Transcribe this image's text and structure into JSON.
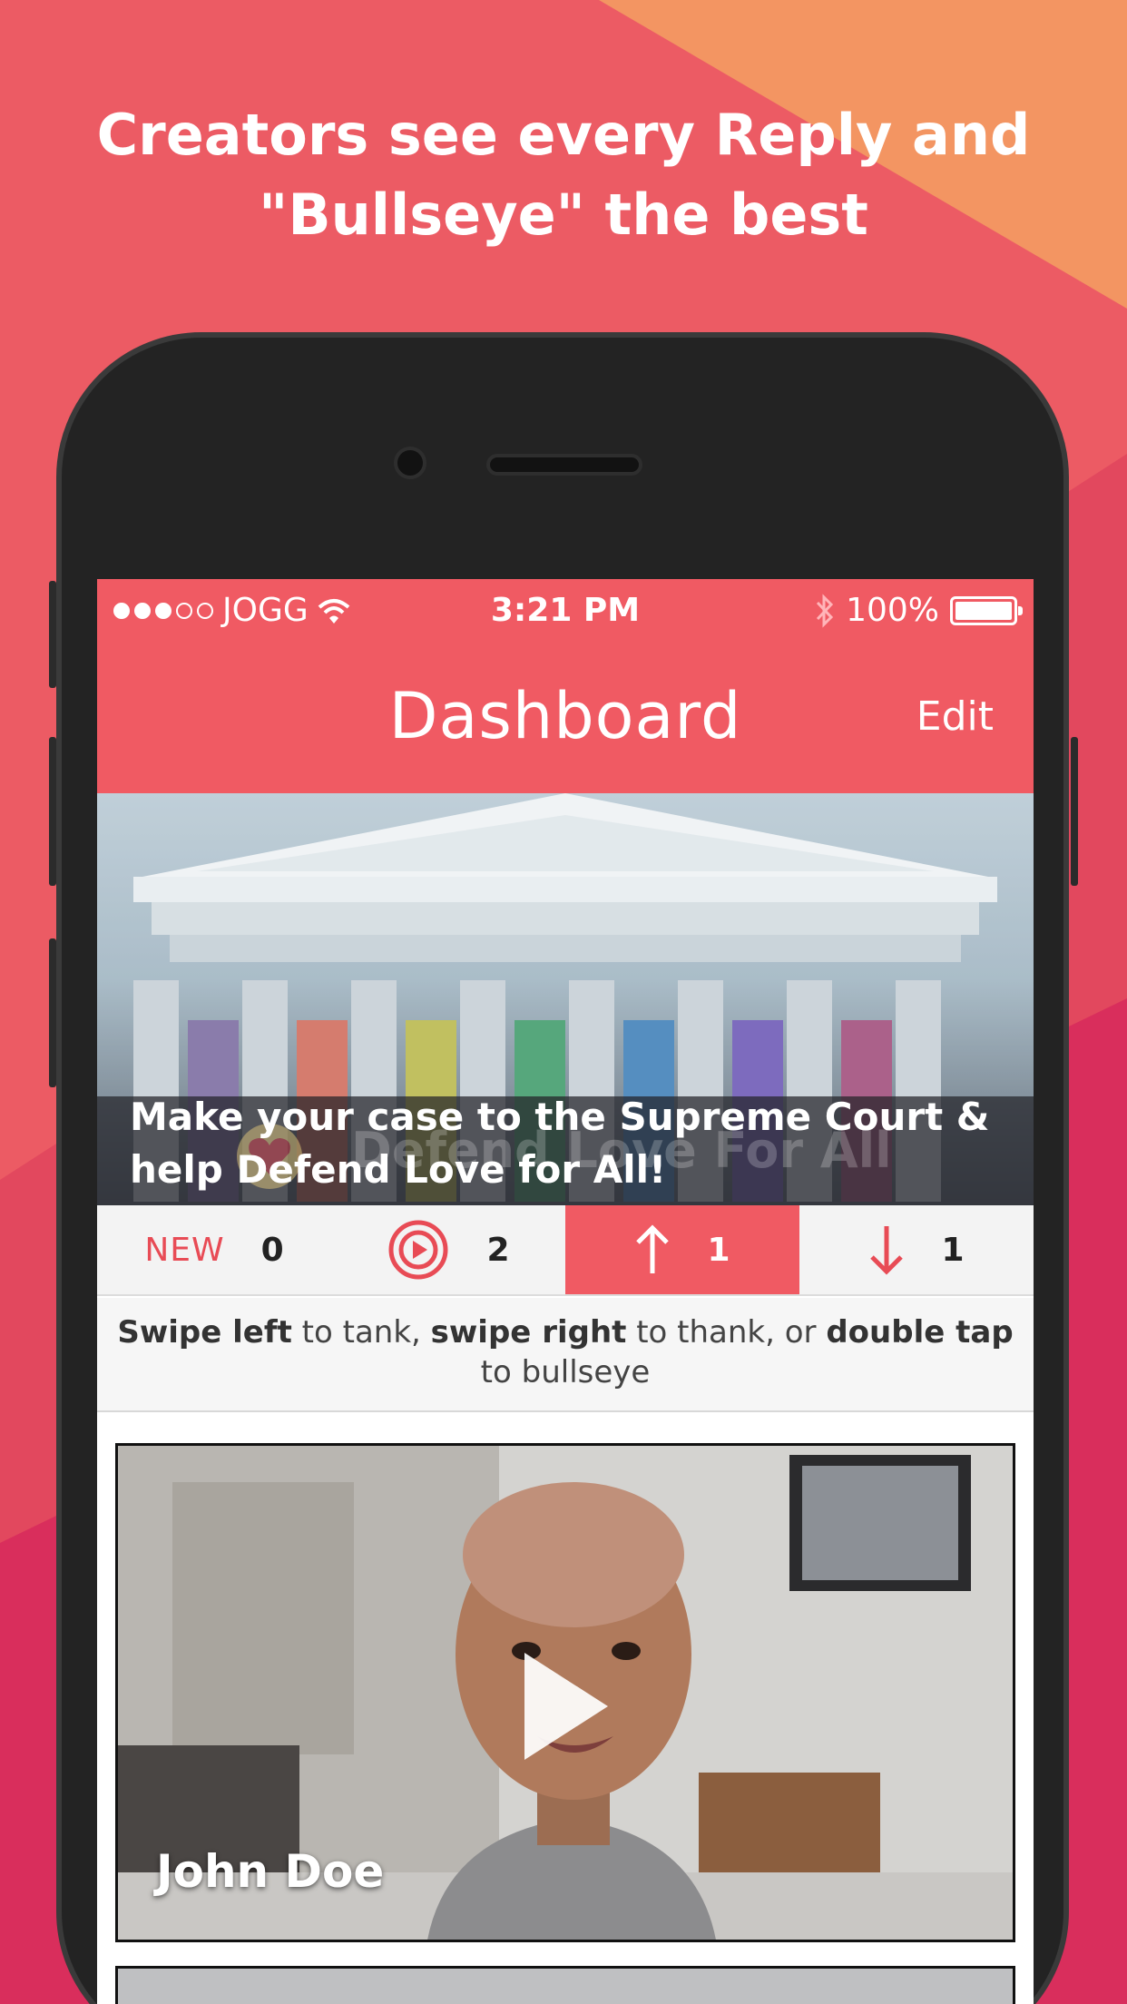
{
  "promo": {
    "headline_line1": "Creators see every Reply and",
    "headline_line2": "\"Bullseye\" the best"
  },
  "status_bar": {
    "carrier": "JOGG",
    "time": "3:21 PM",
    "battery": "100%"
  },
  "nav": {
    "title": "Dashboard",
    "edit_label": "Edit"
  },
  "hero": {
    "title_line1": "Make your case to the Supreme Court &",
    "title_line2": "help Defend Love for All!",
    "watermark": "Defend Love For All"
  },
  "tabs": [
    {
      "label": "NEW",
      "count": "0",
      "icon": "new-label"
    },
    {
      "label": "",
      "count": "2",
      "icon": "bullseye-icon"
    },
    {
      "label": "",
      "count": "1",
      "icon": "arrow-up-icon"
    },
    {
      "label": "",
      "count": "1",
      "icon": "arrow-down-icon"
    }
  ],
  "hint": {
    "swipe_left": "Swipe left",
    "t1": " to tank, ",
    "swipe_right": "swipe right",
    "t2": " to thank, or ",
    "double_tap": "double tap",
    "t3": " to bullseye"
  },
  "videos": [
    {
      "name": "John Doe"
    }
  ],
  "colors": {
    "accent": "#f05a63",
    "background": "#ec5b64",
    "orange": "#f39562"
  }
}
